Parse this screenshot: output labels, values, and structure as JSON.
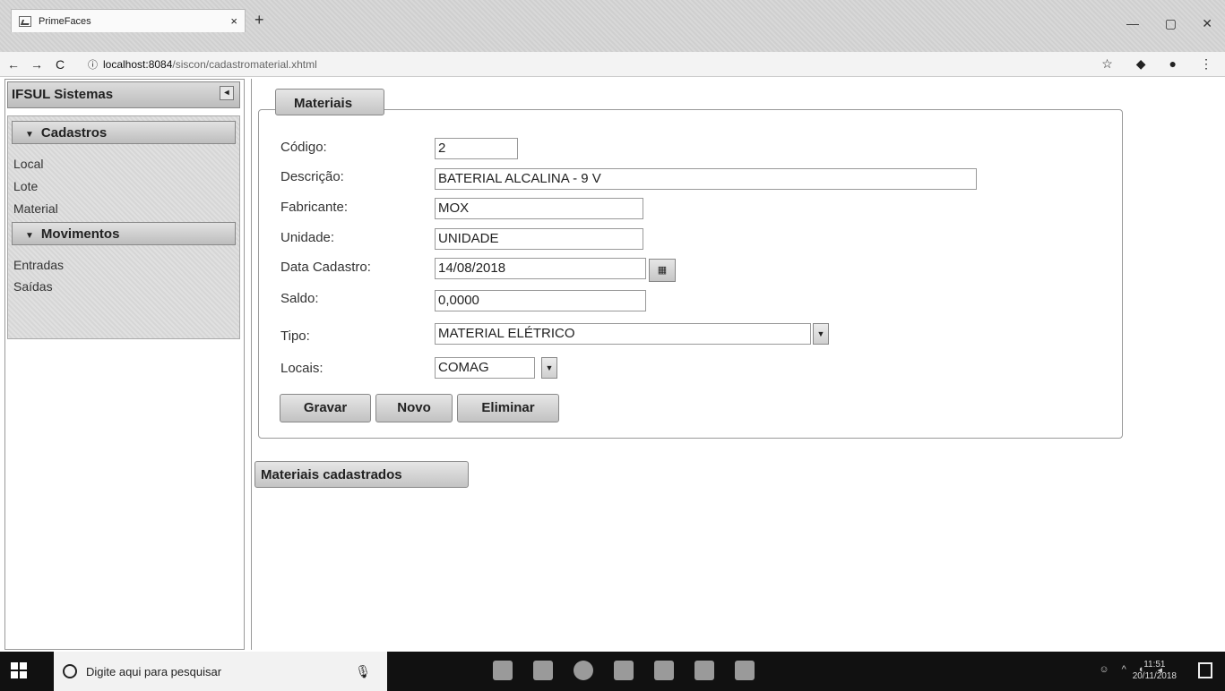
{
  "browser": {
    "tab_title": "PrimeFaces",
    "tab_close": "×",
    "new_tab": "+",
    "url_host": "localhost:8084",
    "url_path": "/siscon/cadastromaterial.xhtml",
    "back": "←",
    "forward": "→",
    "reload": "C",
    "info": "ⓘ",
    "star": "☆",
    "minimize": "—",
    "restore": "▢",
    "close": "✕"
  },
  "sidebar": {
    "title": "IFSUL Sistemas",
    "toggle": "◂",
    "groups": [
      {
        "label": "Cadastros",
        "items": [
          "Local",
          "Lote",
          "Material"
        ]
      },
      {
        "label": "Movimentos",
        "items": [
          "Entradas",
          "Saídas"
        ]
      }
    ]
  },
  "form": {
    "legend": "Materiais",
    "fields": [
      {
        "label": "Código:",
        "value": "2"
      },
      {
        "label": "Descrição:",
        "value": "BATERIAL ALCALINA - 9 V"
      },
      {
        "label": "Fabricante:",
        "value": "MOX"
      },
      {
        "label": "Unidade:",
        "value": "UNIDADE"
      },
      {
        "label": "Data Cadastro:",
        "value": "14/08/2018"
      },
      {
        "label": "Saldo:",
        "value": "0,0000"
      },
      {
        "label": "Tipo:",
        "value": "MATERIAL ELÉTRICO"
      },
      {
        "label": "Locais:",
        "value": "COMAG"
      }
    ],
    "buttons": {
      "save": "Gravar",
      "new": "Novo",
      "delete": "Eliminar"
    }
  },
  "list_panel": {
    "label": "Materiais cadastrados"
  },
  "taskbar": {
    "search_placeholder": "Digite aqui para pesquisar",
    "clock_time": "11:51",
    "clock_date": "20/11/2018"
  }
}
